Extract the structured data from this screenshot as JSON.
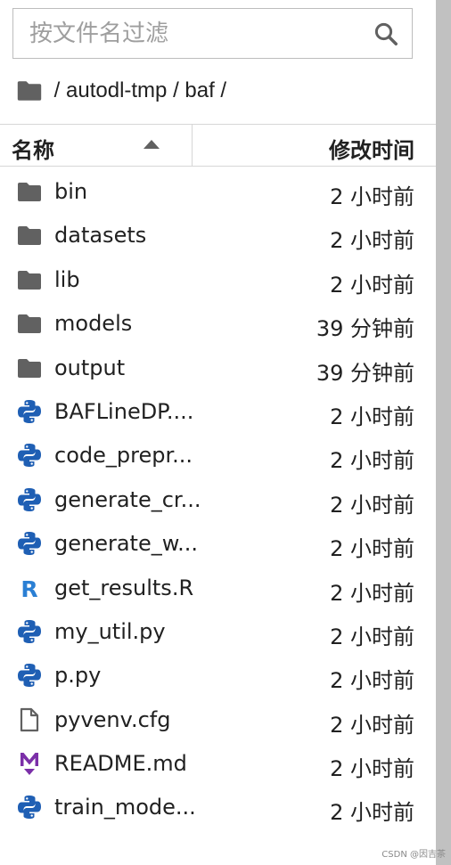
{
  "search": {
    "placeholder": "按文件名过滤",
    "value": ""
  },
  "breadcrumb": {
    "path": " / autodl-tmp / baf /"
  },
  "header": {
    "name_label": "名称",
    "modified_label": "修改时间",
    "sort": "ascending"
  },
  "files": [
    {
      "name": "bin",
      "type": "folder",
      "icon": "folder-icon",
      "modified": "2 小时前"
    },
    {
      "name": "datasets",
      "type": "folder",
      "icon": "folder-icon",
      "modified": "2 小时前"
    },
    {
      "name": "lib",
      "type": "folder",
      "icon": "folder-icon",
      "modified": "2 小时前"
    },
    {
      "name": "models",
      "type": "folder",
      "icon": "folder-icon",
      "modified": "39 分钟前"
    },
    {
      "name": "output",
      "type": "folder",
      "icon": "folder-icon",
      "modified": "39 分钟前"
    },
    {
      "name": "BAFLineDP....",
      "type": "python",
      "icon": "python-icon",
      "modified": "2 小时前"
    },
    {
      "name": "code_prepr...",
      "type": "python",
      "icon": "python-icon",
      "modified": "2 小时前"
    },
    {
      "name": "generate_cr...",
      "type": "python",
      "icon": "python-icon",
      "modified": "2 小时前"
    },
    {
      "name": "generate_w...",
      "type": "python",
      "icon": "python-icon",
      "modified": "2 小时前"
    },
    {
      "name": "get_results.R",
      "type": "r",
      "icon": "r-icon",
      "modified": "2 小时前"
    },
    {
      "name": "my_util.py",
      "type": "python",
      "icon": "python-icon",
      "modified": "2 小时前"
    },
    {
      "name": "p.py",
      "type": "python",
      "icon": "python-icon",
      "modified": "2 小时前"
    },
    {
      "name": "pyvenv.cfg",
      "type": "file",
      "icon": "file-icon",
      "modified": "2 小时前"
    },
    {
      "name": "README.md",
      "type": "markdown",
      "icon": "markdown-icon",
      "modified": "2 小时前"
    },
    {
      "name": "train_mode...",
      "type": "python",
      "icon": "python-icon",
      "modified": "2 小时前"
    }
  ],
  "colors": {
    "folder": "#616161",
    "python_blue": "#1f5fb4",
    "python_yellow": "#ffd43b",
    "r_blue": "#2a7fd4",
    "markdown_purple": "#7b2fa8",
    "border": "#d6d6d6",
    "scrollbar": "#c1c1c1"
  },
  "watermark": "CSDN @因吉茶"
}
